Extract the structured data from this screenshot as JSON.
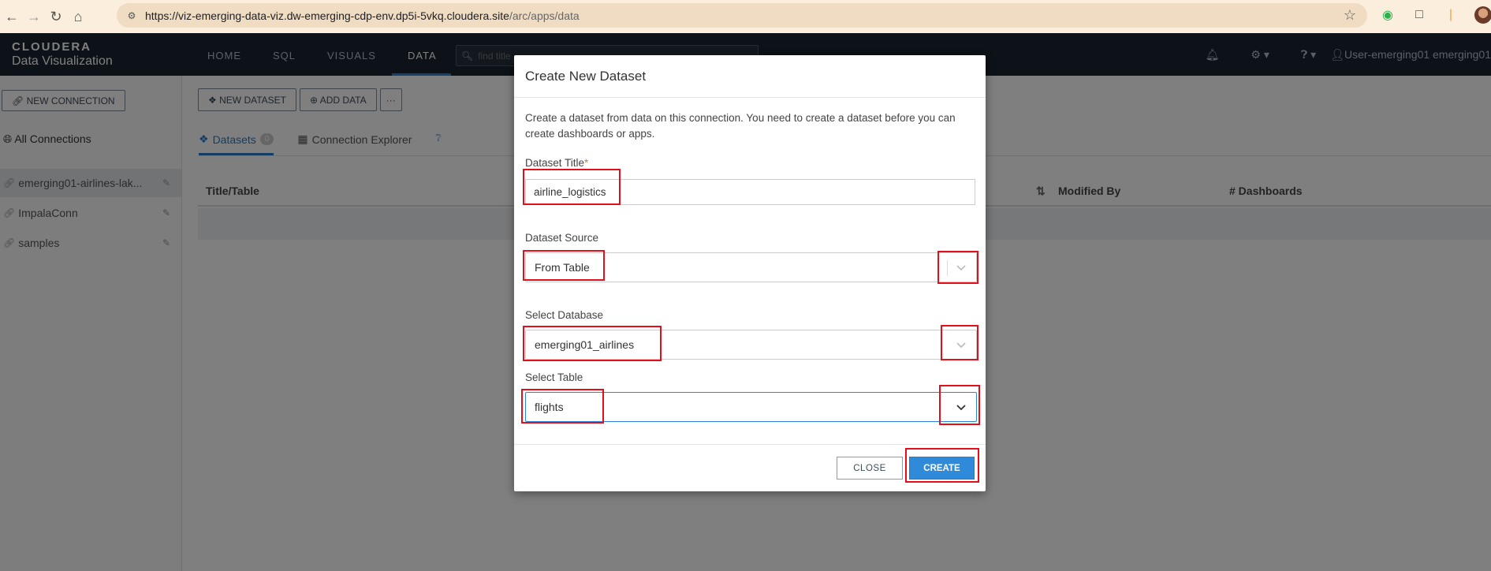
{
  "browser": {
    "url_host": "https://viz-emerging-data-viz.dw-emerging-cdp-env.dp5i-5vkq.cloudera.site",
    "url_path": "/arc/apps/data"
  },
  "app": {
    "brand": "CLOUDERA",
    "product": "Data Visualization",
    "nav": [
      "HOME",
      "SQL",
      "VISUALS",
      "DATA"
    ],
    "active_nav": "DATA",
    "search_placeholder": "find title",
    "user": "User-emerging01  emerging01"
  },
  "sidebar": {
    "new_connection": "NEW CONNECTION",
    "all_connections": "All Connections",
    "connections": [
      {
        "label": "emerging01-airlines-lak..."
      },
      {
        "label": "ImpalaConn"
      },
      {
        "label": "samples"
      }
    ]
  },
  "main": {
    "toolbar": {
      "new_dataset": "NEW DATASET",
      "add_data": "ADD DATA",
      "more": "···"
    },
    "tabs": {
      "datasets": "Datasets",
      "datasets_count": "0",
      "explorer": "Connection Explorer"
    },
    "columns": {
      "title": "Title/Table",
      "modified_by": "Modified By",
      "dashboards": "# Dashboards"
    }
  },
  "modal": {
    "title": "Create New Dataset",
    "description": "Create a dataset from data on this connection. You need to create a dataset before you can create dashboards or apps.",
    "dataset_title_label": "Dataset Title",
    "required_mark": "*",
    "dataset_title_value": "airline_logistics",
    "source_label": "Dataset Source",
    "source_value": "From Table",
    "database_label": "Select Database",
    "database_value": "emerging01_airlines",
    "table_label": "Select Table",
    "table_value": "flights",
    "close_label": "CLOSE",
    "create_label": "CREATE"
  },
  "colors": {
    "accent": "#2f8ad9",
    "highlight": "#e3101c",
    "header": "#1b2530"
  }
}
